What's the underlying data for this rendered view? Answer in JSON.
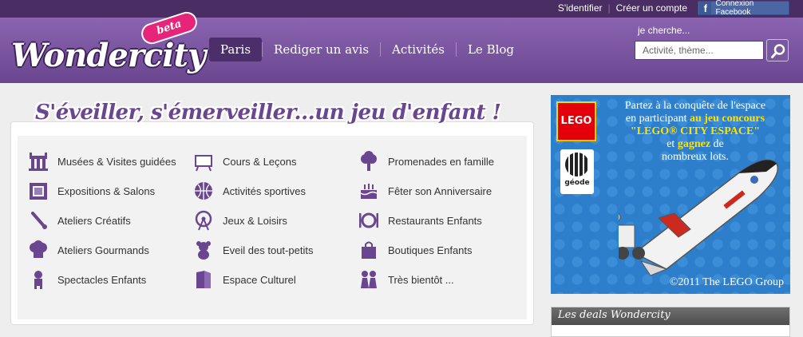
{
  "topbar": {
    "signin": "S'identifier",
    "register": "Créer un compte",
    "facebook": "Connexion Facebook"
  },
  "logo": {
    "name": "Wondercity",
    "badge": "beta"
  },
  "nav": [
    "Paris",
    "Rediger un avis",
    "Activités",
    "Le Blog"
  ],
  "search": {
    "label": "je cherche...",
    "placeholder": "Activité, thème..."
  },
  "tagline": "S'éveiller, s'émerveiller...un jeu d'enfant !",
  "categories": {
    "col1": [
      "Musées & Visites guidées",
      "Expositions & Salons",
      "Ateliers Créatifs",
      "Ateliers Gourmands",
      "Spectacles Enfants"
    ],
    "col2": [
      "Cours & Leçons",
      "Activités sportives",
      "Jeux & Loisirs",
      "Eveil des tout-petits",
      "Espace Culturel"
    ],
    "col3": [
      "Promenades en famille",
      "Fêter son Anniversaire",
      "Restaurants Enfants",
      "Boutiques Enfants",
      "Très bientôt ..."
    ]
  },
  "ad": {
    "lego": "LEGO",
    "geode": "géode",
    "line1": "Partez à la conquête de l'espace",
    "line2a": "en participant ",
    "line2b": "au jeu concours",
    "line3": "\"LEGO® CITY ESPACE\"",
    "line4a": "et ",
    "line4b": "gagnez",
    "line4c": " de",
    "line5": "nombreux lots.",
    "copyright": "©2011 The LEGO Group"
  },
  "deals": {
    "title": "Les deals Wondercity"
  },
  "colors": {
    "purple": "#6a4690",
    "dark_purple": "#4a2d63",
    "facebook": "#4c66a4",
    "lego_red": "#e3000b"
  }
}
